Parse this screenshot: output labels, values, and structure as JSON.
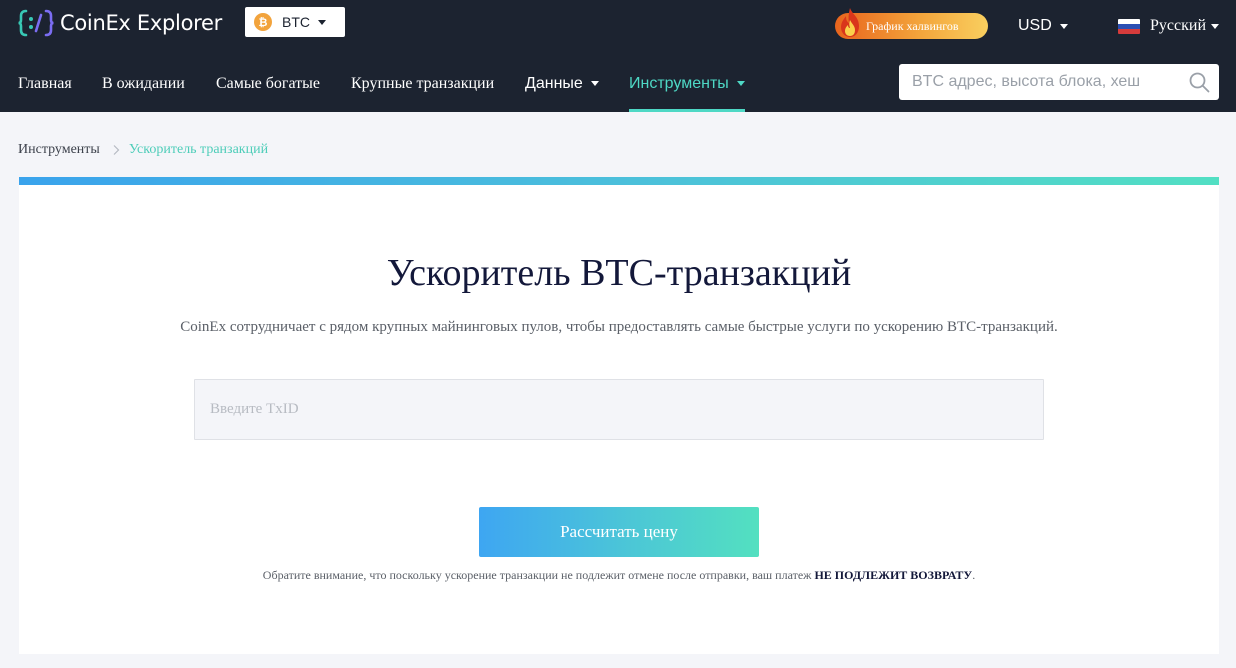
{
  "header": {
    "logo_text": "CoinEx Explorer",
    "coin_select": {
      "value": "BTC",
      "icon": "bitcoin-icon"
    },
    "halving_button": "График халвингов",
    "currency": "USD",
    "language": "Русский"
  },
  "nav": {
    "items": [
      {
        "label": "Главная"
      },
      {
        "label": "В ожидании"
      },
      {
        "label": "Самые богатые"
      },
      {
        "label": "Крупные транзакции"
      },
      {
        "label": "Данные"
      },
      {
        "label": "Инструменты"
      }
    ],
    "active": "Инструменты"
  },
  "search": {
    "placeholder": "BTC адрес, высота блока, хеш",
    "value": ""
  },
  "breadcrumb": {
    "root": "Инструменты",
    "current": "Ускоритель транзакций"
  },
  "main": {
    "title": "Ускоритель BTC-транзакций",
    "subtitle": "CoinEx сотрудничает с рядом крупных майнинговых пулов, чтобы предоставлять самые быстрые услуги по ускорению BTC-транзакций.",
    "txid_placeholder": "Введите TxID",
    "txid_value": "",
    "calculate_button": "Рассчитать цену",
    "note_prefix": "Обратите внимание, что поскольку ускорение транзакции не подлежит отмене после отправки, ваш платеж ",
    "note_bold": "НЕ ПОДЛЕЖИТ ВОЗВРАТУ",
    "note_suffix": "."
  },
  "colors": {
    "header_bg": "#1c2330",
    "accent": "#4ed8c5",
    "page_bg": "#f4f5f9",
    "title": "#13183a"
  }
}
